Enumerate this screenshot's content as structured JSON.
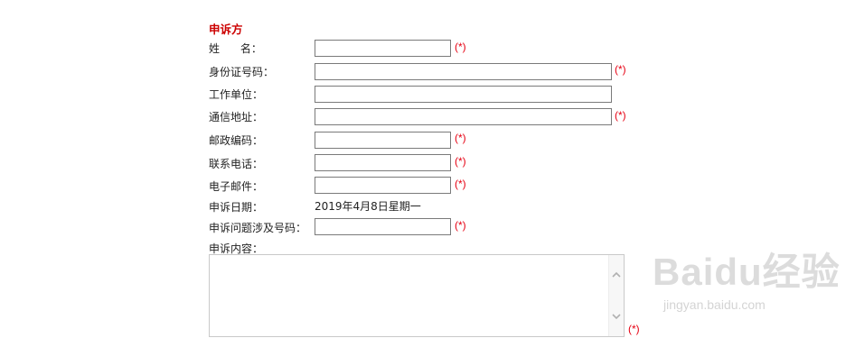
{
  "form": {
    "section_title": "申诉方",
    "required_mark": "(*)",
    "fields": {
      "name": {
        "label": "姓      名：",
        "value": ""
      },
      "id_number": {
        "label": "身份证号码：",
        "value": ""
      },
      "workplace": {
        "label": "工作单位：",
        "value": ""
      },
      "address": {
        "label": "通信地址：",
        "value": ""
      },
      "postcode": {
        "label": "邮政编码：",
        "value": ""
      },
      "phone": {
        "label": "联系电话：",
        "value": ""
      },
      "email": {
        "label": "电子邮件：",
        "value": ""
      },
      "date": {
        "label": "申诉日期：",
        "value": "2019年4月8日星期一"
      },
      "issue_number": {
        "label": "申诉问题涉及号码：",
        "value": ""
      },
      "content": {
        "label": "申诉内容：",
        "value": ""
      }
    }
  },
  "watermark": {
    "brand": "Baidu经验",
    "url": "jingyan.baidu.com"
  },
  "colors": {
    "title": "#cc0000",
    "required": "#e60012",
    "border": "#7a7a7a"
  }
}
